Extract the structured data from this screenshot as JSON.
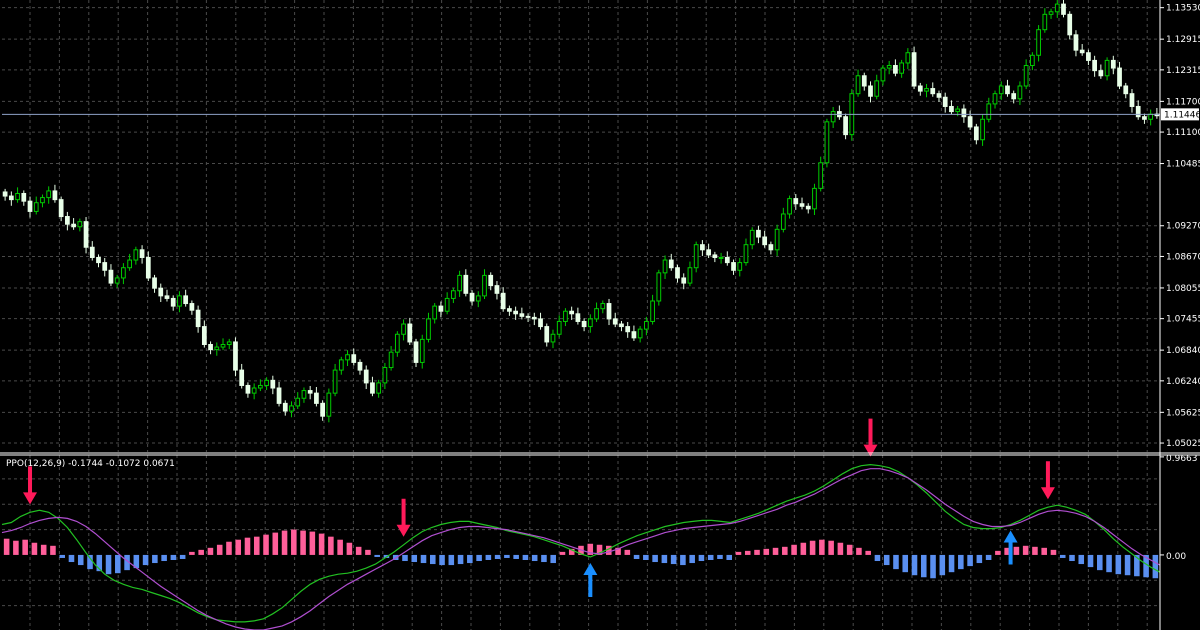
{
  "colors": {
    "background": "#000000",
    "grid": "#4a4a4a",
    "axis": "#ffffff",
    "bull_candle": "#e8ffe8",
    "bear_candle": "#00cc00",
    "price_line": "#8fa3c8",
    "ppo_line": "#22c022",
    "signal_line": "#b04fd0",
    "hist_positive": "#ff5f9a",
    "hist_negative": "#5a8ff0",
    "arrow_down": "#ff1a5a",
    "arrow_up": "#1a8fff"
  },
  "chart_data": [
    {
      "type": "candlestick",
      "ylim": [
        1.0485,
        1.1368
      ],
      "yticks": [
        "1.13530",
        "1.12915",
        "1.12315",
        "1.11700",
        "1.11100",
        "1.10485",
        "1.09270",
        "1.08670",
        "1.08055",
        "1.07455",
        "1.06840",
        "1.06240",
        "1.05625",
        "1.05025"
      ],
      "current_price": "1.11446",
      "current_price_value": 1.11446,
      "grid": true,
      "close": [
        1.0985,
        1.0978,
        1.099,
        1.0975,
        1.0955,
        1.0972,
        1.0982,
        1.0995,
        1.0978,
        1.0945,
        1.093,
        1.0925,
        1.0935,
        1.0885,
        1.0865,
        1.0855,
        1.084,
        1.0815,
        1.0825,
        1.0845,
        1.086,
        1.088,
        1.0865,
        1.0825,
        1.0805,
        1.079,
        1.0785,
        1.077,
        1.079,
        1.0775,
        1.0762,
        1.073,
        1.0695,
        1.0685,
        1.069,
        1.0695,
        1.07,
        1.0645,
        1.0615,
        1.06,
        1.061,
        1.0615,
        1.0625,
        1.061,
        1.058,
        1.0565,
        1.0575,
        1.059,
        1.0605,
        1.06,
        1.058,
        1.0555,
        1.06,
        1.0645,
        1.0665,
        1.0675,
        1.066,
        1.0645,
        1.062,
        1.06,
        1.062,
        1.065,
        1.068,
        1.0715,
        1.0735,
        1.07,
        1.066,
        1.0705,
        1.0745,
        1.077,
        1.076,
        1.0785,
        1.08,
        1.083,
        1.0795,
        1.078,
        1.079,
        1.083,
        1.081,
        1.0795,
        1.0765,
        1.076,
        1.0755,
        1.075,
        1.0748,
        1.0745,
        1.073,
        1.07,
        1.0715,
        1.074,
        1.076,
        1.0755,
        1.074,
        1.073,
        1.0745,
        1.0765,
        1.0775,
        1.0745,
        1.0735,
        1.073,
        1.072,
        1.0708,
        1.0725,
        1.074,
        1.078,
        1.0835,
        1.086,
        1.0845,
        1.0825,
        1.0815,
        1.0845,
        1.089,
        1.088,
        1.087,
        1.0865,
        1.0865,
        1.0855,
        1.084,
        1.0855,
        1.089,
        1.0918,
        1.0905,
        1.089,
        1.088,
        1.092,
        1.095,
        1.098,
        1.097,
        1.0965,
        1.096,
        1.1,
        1.105,
        1.113,
        1.115,
        1.114,
        1.1105,
        1.1185,
        1.122,
        1.12,
        1.118,
        1.121,
        1.1235,
        1.124,
        1.1225,
        1.1245,
        1.1265,
        1.12,
        1.119,
        1.1195,
        1.1185,
        1.1178,
        1.116,
        1.115,
        1.1155,
        1.114,
        1.112,
        1.1095,
        1.1135,
        1.1165,
        1.1185,
        1.12,
        1.1185,
        1.1175,
        1.12,
        1.124,
        1.126,
        1.131,
        1.134,
        1.1345,
        1.136,
        1.134,
        1.13,
        1.127,
        1.1265,
        1.125,
        1.123,
        1.122,
        1.125,
        1.1235,
        1.12,
        1.1185,
        1.116,
        1.114,
        1.1135,
        1.1145,
        1.1142
      ]
    },
    {
      "type": "line",
      "indicator_label": "PPO(12,26,9) -0.1744 -0.1072 0.0671",
      "ylim": [
        -0.74,
        0.985
      ],
      "yticks": [
        "0.9663",
        "0.00"
      ],
      "grid": true,
      "series": [
        {
          "values": [
            0.3,
            0.32,
            0.38,
            0.42,
            0.44,
            0.42,
            0.36,
            0.27,
            0.15,
            0.02,
            -0.1,
            -0.19,
            -0.25,
            -0.29,
            -0.32,
            -0.34,
            -0.37,
            -0.4,
            -0.43,
            -0.47,
            -0.52,
            -0.57,
            -0.61,
            -0.64,
            -0.65,
            -0.66,
            -0.66,
            -0.65,
            -0.63,
            -0.58,
            -0.52,
            -0.44,
            -0.36,
            -0.29,
            -0.24,
            -0.21,
            -0.19,
            -0.18,
            -0.16,
            -0.13,
            -0.09,
            -0.03,
            0.03,
            0.1,
            0.17,
            0.23,
            0.27,
            0.3,
            0.32,
            0.33,
            0.33,
            0.31,
            0.29,
            0.27,
            0.24,
            0.22,
            0.2,
            0.18,
            0.15,
            0.12,
            0.09,
            0.05,
            0.01,
            -0.02,
            0.02,
            0.06,
            0.11,
            0.15,
            0.19,
            0.22,
            0.25,
            0.28,
            0.3,
            0.32,
            0.33,
            0.34,
            0.34,
            0.33,
            0.32,
            0.35,
            0.38,
            0.41,
            0.45,
            0.49,
            0.53,
            0.56,
            0.59,
            0.63,
            0.68,
            0.74,
            0.8,
            0.85,
            0.88,
            0.89,
            0.88,
            0.86,
            0.82,
            0.76,
            0.69,
            0.61,
            0.52,
            0.43,
            0.36,
            0.3,
            0.27,
            0.26,
            0.26,
            0.27,
            0.3,
            0.34,
            0.39,
            0.44,
            0.47,
            0.49,
            0.47,
            0.44,
            0.4,
            0.33,
            0.25,
            0.16,
            0.08,
            0.01,
            -0.06,
            -0.12,
            -0.17
          ]
        },
        {
          "values": [
            0.22,
            0.24,
            0.27,
            0.31,
            0.34,
            0.36,
            0.37,
            0.36,
            0.33,
            0.28,
            0.21,
            0.13,
            0.05,
            -0.03,
            -0.1,
            -0.17,
            -0.24,
            -0.31,
            -0.37,
            -0.43,
            -0.49,
            -0.55,
            -0.6,
            -0.64,
            -0.68,
            -0.71,
            -0.73,
            -0.74,
            -0.74,
            -0.72,
            -0.7,
            -0.66,
            -0.61,
            -0.55,
            -0.48,
            -0.41,
            -0.35,
            -0.29,
            -0.24,
            -0.19,
            -0.14,
            -0.09,
            -0.04,
            0.02,
            0.08,
            0.14,
            0.19,
            0.22,
            0.25,
            0.27,
            0.28,
            0.28,
            0.27,
            0.26,
            0.25,
            0.23,
            0.21,
            0.19,
            0.17,
            0.14,
            0.11,
            0.08,
            0.05,
            0.02,
            0.01,
            0.03,
            0.06,
            0.1,
            0.13,
            0.16,
            0.19,
            0.22,
            0.24,
            0.26,
            0.27,
            0.28,
            0.29,
            0.3,
            0.31,
            0.33,
            0.36,
            0.39,
            0.42,
            0.45,
            0.49,
            0.52,
            0.56,
            0.6,
            0.65,
            0.7,
            0.75,
            0.79,
            0.83,
            0.85,
            0.85,
            0.83,
            0.8,
            0.76,
            0.7,
            0.64,
            0.57,
            0.5,
            0.44,
            0.38,
            0.33,
            0.3,
            0.28,
            0.28,
            0.29,
            0.32,
            0.36,
            0.4,
            0.43,
            0.44,
            0.43,
            0.41,
            0.38,
            0.33,
            0.27,
            0.2,
            0.13,
            0.06,
            0.0,
            -0.05,
            -0.1
          ]
        }
      ],
      "histogram_values": [
        0.16,
        0.14,
        0.15,
        0.12,
        0.1,
        0.09,
        -0.03,
        -0.07,
        -0.1,
        -0.14,
        -0.16,
        -0.19,
        -0.18,
        -0.15,
        -0.13,
        -0.1,
        -0.08,
        -0.06,
        -0.05,
        -0.04,
        0.03,
        0.05,
        0.07,
        0.1,
        0.13,
        0.15,
        0.17,
        0.18,
        0.2,
        0.22,
        0.24,
        0.25,
        0.24,
        0.23,
        0.21,
        0.18,
        0.15,
        0.12,
        0.08,
        0.05,
        -0.02,
        -0.03,
        -0.05,
        -0.06,
        -0.07,
        -0.08,
        -0.09,
        -0.1,
        -0.1,
        -0.09,
        -0.08,
        -0.06,
        -0.05,
        -0.04,
        -0.03,
        -0.04,
        -0.05,
        -0.06,
        -0.07,
        -0.08,
        0.03,
        0.06,
        0.09,
        0.11,
        0.1,
        0.09,
        0.07,
        0.05,
        -0.04,
        -0.05,
        -0.07,
        -0.08,
        -0.09,
        -0.1,
        -0.08,
        -0.06,
        -0.05,
        -0.04,
        -0.05,
        0.03,
        0.04,
        0.05,
        0.06,
        0.07,
        0.08,
        0.1,
        0.12,
        0.14,
        0.15,
        0.14,
        0.12,
        0.1,
        0.07,
        0.04,
        -0.06,
        -0.1,
        -0.14,
        -0.17,
        -0.2,
        -0.22,
        -0.23,
        -0.2,
        -0.17,
        -0.14,
        -0.11,
        -0.08,
        -0.05,
        0.04,
        0.07,
        0.08,
        0.09,
        0.08,
        0.07,
        0.05,
        -0.03,
        -0.06,
        -0.09,
        -0.12,
        -0.15,
        -0.17,
        -0.19,
        -0.2,
        -0.21,
        -0.22,
        -0.23
      ],
      "arrows": [
        {
          "direction": "down",
          "index": 3
        },
        {
          "direction": "down",
          "index": 43
        },
        {
          "direction": "up",
          "index": 63
        },
        {
          "direction": "down",
          "index": 93
        },
        {
          "direction": "up",
          "index": 108
        },
        {
          "direction": "down",
          "index": 112
        }
      ]
    }
  ]
}
